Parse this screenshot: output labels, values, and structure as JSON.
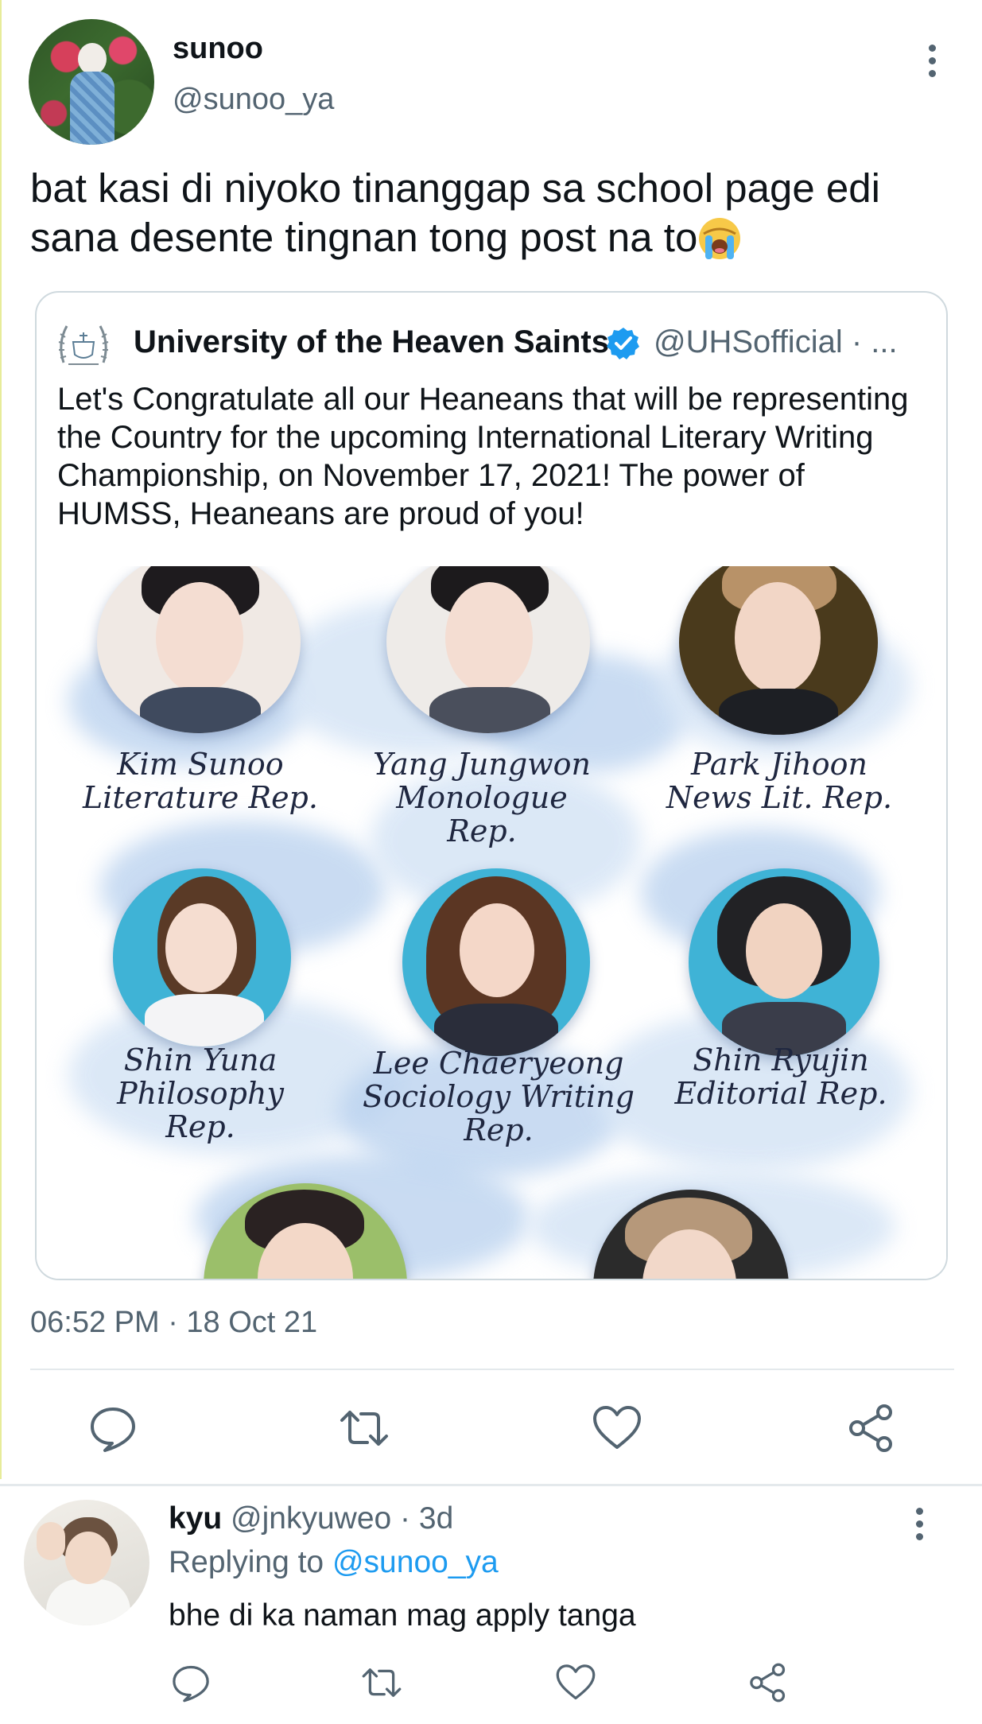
{
  "tweet": {
    "display_name": "sunoo",
    "handle": "@sunoo_ya",
    "text": "bat kasi di niyoko tinanggap sa school page edi sana desente tingnan tong post na to",
    "emoji": "loudly-crying-face-emoji",
    "timestamp": "06:52 PM · 18 Oct 21"
  },
  "quote": {
    "name": "University of the Heaven Saints",
    "handle": "@UHSofficial · ...",
    "verified": true,
    "text": "Let's Congratulate all our Heaneans that will be representing the Country for the upcoming International Literary Writing Championship, on November 17, 2021! The power of HUMSS, Heaneans are proud of you!",
    "representatives": [
      {
        "name": "Kim Sunoo",
        "role": "Literature Rep."
      },
      {
        "name": "Yang Jungwon",
        "role": "Monologue Rep."
      },
      {
        "name": "Park Jihoon",
        "role": "News Lit. Rep."
      },
      {
        "name": "Shin Yuna",
        "role": "Philosophy Rep."
      },
      {
        "name": "Lee Chaeryeong",
        "role": "Sociology Writing Rep."
      },
      {
        "name": "Shin Ryujin",
        "role": "Editorial Rep."
      }
    ]
  },
  "actions": [
    "reply-icon",
    "retweet-icon",
    "like-icon",
    "share-icon"
  ],
  "reply": {
    "display_name": "kyu",
    "meta": "@jnkyuweo · 3d",
    "replying_prefix": "Replying to",
    "replying_to": "@sunoo_ya",
    "text": "bhe di ka naman mag apply tanga"
  },
  "colors": {
    "accent": "#1d9bf0",
    "secondary_text": "#536471",
    "border": "#cfd9de"
  }
}
